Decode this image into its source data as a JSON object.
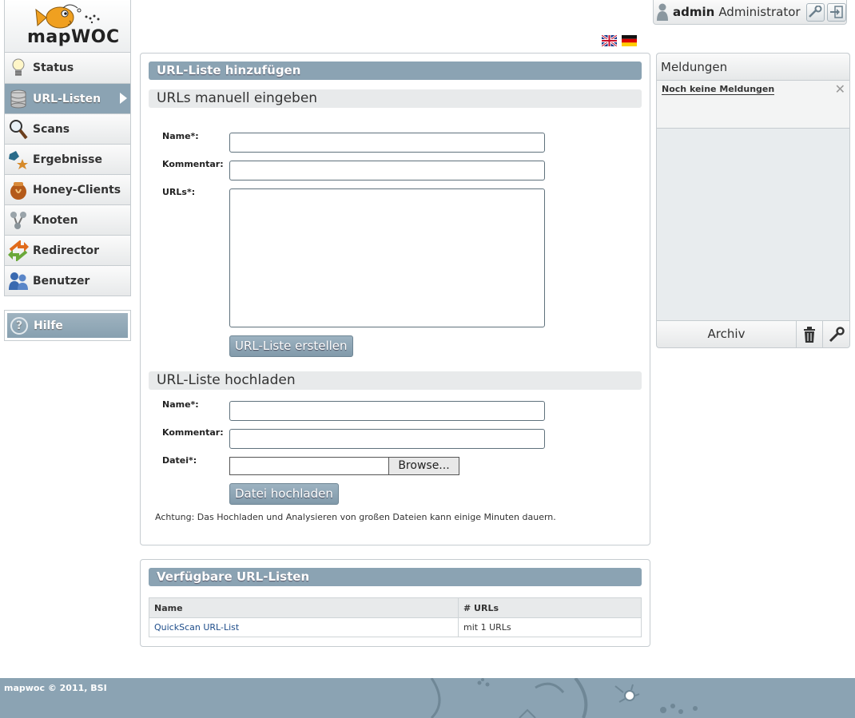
{
  "logo": {
    "text": "mapWOC"
  },
  "nav": {
    "items": [
      {
        "label": "Status",
        "icon": "lightbulb-icon"
      },
      {
        "label": "URL-Listen",
        "icon": "database-icon"
      },
      {
        "label": "Scans",
        "icon": "magnifier-icon"
      },
      {
        "label": "Ergebnisse",
        "icon": "results-icon"
      },
      {
        "label": "Honey-Clients",
        "icon": "honeypot-icon"
      },
      {
        "label": "Knoten",
        "icon": "nodes-icon"
      },
      {
        "label": "Redirector",
        "icon": "redirect-arrows-icon"
      },
      {
        "label": "Benutzer",
        "icon": "users-icon"
      }
    ],
    "active_index": 1,
    "help_label": "Hilfe"
  },
  "user": {
    "name": "admin",
    "role": "Administrator"
  },
  "main": {
    "title": "URL-Liste hinzufügen",
    "manual": {
      "heading": "URLs manuell eingeben",
      "name_label": "Name*:",
      "comment_label": "Kommentar:",
      "urls_label": "URLs*:",
      "submit_label": "URL-Liste erstellen"
    },
    "upload": {
      "heading": "URL-Liste hochladen",
      "name_label": "Name*:",
      "comment_label": "Kommentar:",
      "file_label": "Datei*:",
      "browse_label": "Browse...",
      "submit_label": "Datei hochladen",
      "note": "Achtung: Das Hochladen und Analysieren von großen Dateien kann einige Minuten dauern."
    }
  },
  "available": {
    "title": "Verfügbare URL-Listen",
    "columns": [
      "Name",
      "# URLs"
    ],
    "rows": [
      {
        "name": "QuickScan URL-List",
        "count": "mit 1 URLs"
      }
    ]
  },
  "messages": {
    "title": "Meldungen",
    "empty_text": "Noch keine Meldungen",
    "archive_label": "Archiv"
  },
  "footer": {
    "text": "mapwoc © 2011, BSI"
  },
  "colors": {
    "accent": "#8ba3b3",
    "section_bg": "#e8eaeb",
    "link": "#1e4d8a"
  }
}
